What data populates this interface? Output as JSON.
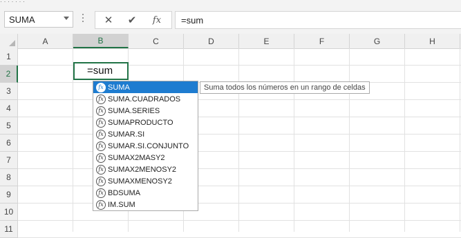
{
  "name_box": {
    "value": "SUMA"
  },
  "formula_bar": {
    "cancel_icon": "close-icon",
    "enter_icon": "check-icon",
    "insert_function_icon": "fx-icon",
    "cancel_glyph": "✕",
    "enter_glyph": "✔",
    "fx_glyph": "fx",
    "value": "=sum"
  },
  "columns": [
    "A",
    "B",
    "C",
    "D",
    "E",
    "F",
    "G",
    "H"
  ],
  "rows": [
    "1",
    "2",
    "3",
    "4",
    "5",
    "6",
    "7",
    "8",
    "9",
    "10",
    "11"
  ],
  "active_cell": {
    "ref": "B2",
    "value": "=sum"
  },
  "autocomplete": {
    "items": [
      "SUMA",
      "SUMA.CUADRADOS",
      "SUMA.SERIES",
      "SUMAPRODUCTO",
      "SUMAR.SI",
      "SUMAR.SI.CONJUNTO",
      "SUMAX2MASY2",
      "SUMAX2MENOSY2",
      "SUMAXMENOSY2",
      "BDSUMA",
      "IM.SUM"
    ],
    "selected": "SUMA",
    "item_icon_glyph": "fx",
    "tooltip": "Suma todos los números en un rango de celdas"
  },
  "colors": {
    "accent": "#217346",
    "selection": "#1e7cd0"
  }
}
